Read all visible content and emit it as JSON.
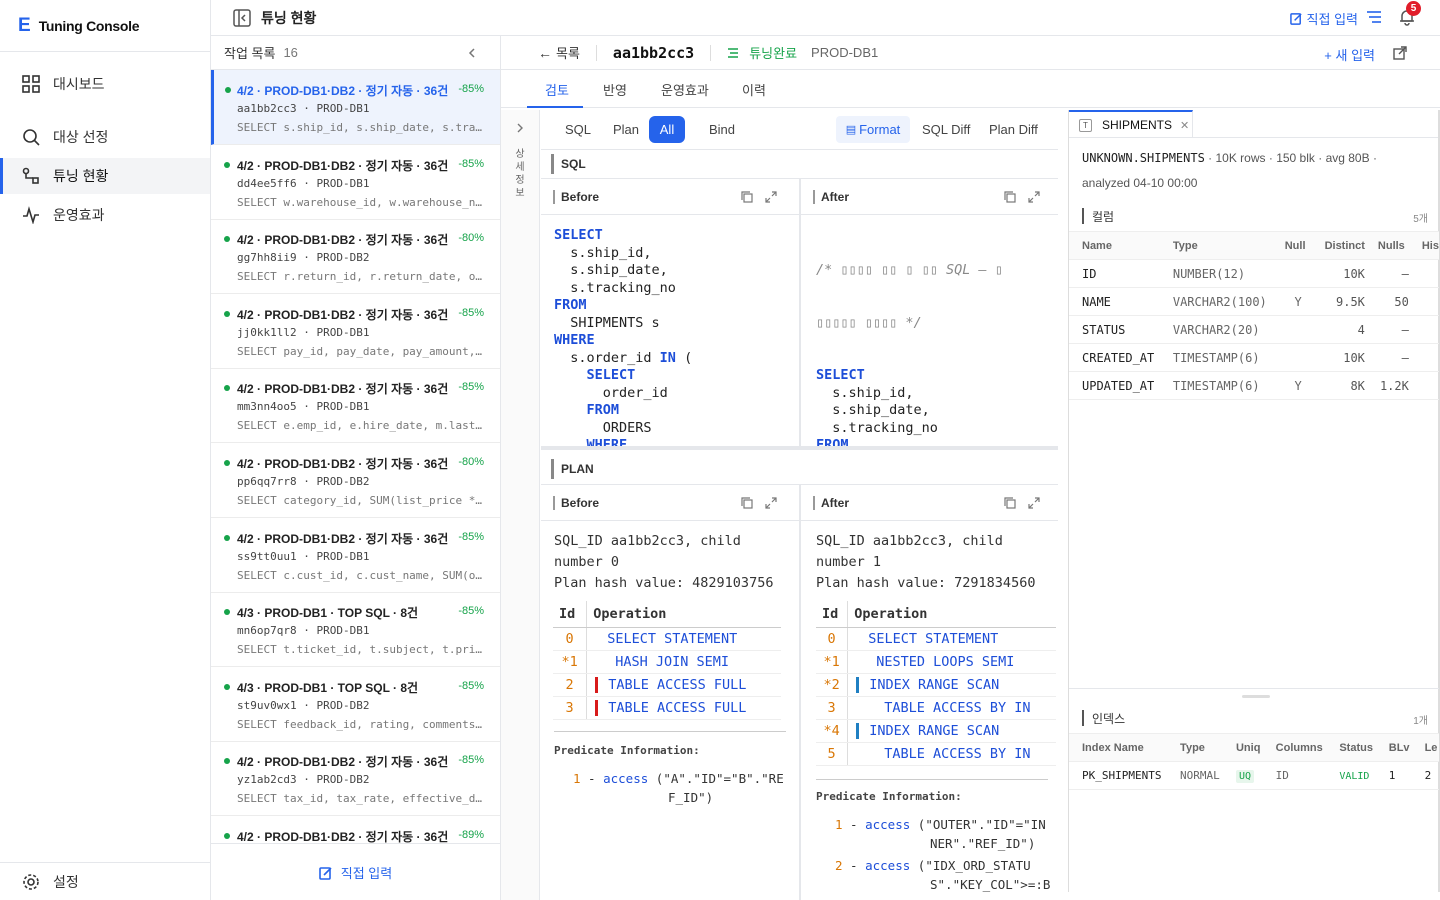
{
  "brand": {
    "logo": "E",
    "name": "Tuning Console"
  },
  "nav": {
    "items": [
      {
        "label": "대시보드",
        "icon": "grid-icon"
      },
      {
        "label": "대상 선정",
        "icon": "search-icon"
      },
      {
        "label": "튜닝 현황",
        "icon": "route-icon"
      },
      {
        "label": "운영효과",
        "icon": "activity-icon"
      }
    ],
    "active": "튜닝 현황",
    "settings": "설정"
  },
  "topbar": {
    "title": "튜닝 현황",
    "direct_input": "직접 입력",
    "notifications": "5"
  },
  "list": {
    "title": "작업 목록",
    "count": "16",
    "footer": "직접 입력",
    "jobs": [
      {
        "title": "4/2 · PROD-DB1·DB2 · 정기 자동 · 36건",
        "pct": "-85%",
        "id": "aa1bb2cc3 · PROD-DB1",
        "sql": "SELECT s.ship_id, s.ship_date, s.tracking_no"
      },
      {
        "title": "4/2 · PROD-DB1·DB2 · 정기 자동 · 36건",
        "pct": "-85%",
        "id": "dd4ee5ff6 · PROD-DB1",
        "sql": "SELECT w.warehouse_id, w.warehouse_name"
      },
      {
        "title": "4/2 · PROD-DB1·DB2 · 정기 자동 · 36건",
        "pct": "-80%",
        "id": "gg7hh8ii9 · PROD-DB2",
        "sql": "SELECT r.return_id, r.return_date, o.order_id"
      },
      {
        "title": "4/2 · PROD-DB1·DB2 · 정기 자동 · 36건",
        "pct": "-85%",
        "id": "jj0kk1ll2 · PROD-DB1",
        "sql": "SELECT pay_id, pay_date, pay_amount, status"
      },
      {
        "title": "4/2 · PROD-DB1·DB2 · 정기 자동 · 36건",
        "pct": "-85%",
        "id": "mm3nn4oo5 · PROD-DB1",
        "sql": "SELECT e.emp_id, e.hire_date, m.last_name"
      },
      {
        "title": "4/2 · PROD-DB1·DB2 · 정기 자동 · 36건",
        "pct": "-80%",
        "id": "pp6qq7rr8 · PROD-DB2",
        "sql": "SELECT category_id, SUM(list_price * qty)"
      },
      {
        "title": "4/2 · PROD-DB1·DB2 · 정기 자동 · 36건",
        "pct": "-85%",
        "id": "ss9tt0uu1 · PROD-DB1",
        "sql": "SELECT c.cust_id, c.cust_name, SUM(o.amount)"
      },
      {
        "title": "4/3 · PROD-DB1 · TOP SQL · 8건",
        "pct": "-85%",
        "id": "mn6op7qr8 · PROD-DB1",
        "sql": "SELECT t.ticket_id, t.subject, t.priority"
      },
      {
        "title": "4/3 · PROD-DB1 · TOP SQL · 8건",
        "pct": "-85%",
        "id": "st9uv0wx1 · PROD-DB2",
        "sql": "SELECT feedback_id, rating, comments, created"
      },
      {
        "title": "4/2 · PROD-DB1·DB2 · 정기 자동 · 36건",
        "pct": "-85%",
        "id": "yz1ab2cd3 · PROD-DB2",
        "sql": "SELECT tax_id, tax_rate, effective_date"
      },
      {
        "title": "4/2 · PROD-DB1·DB2 · 정기 자동 · 36건",
        "pct": "-89%",
        "id": "",
        "sql": ""
      }
    ]
  },
  "main": {
    "back": "목록",
    "sql_id": "aa1bb2cc3",
    "status": "튜닝완료",
    "db": "PROD-DB1",
    "new_input": "+ 새 입력",
    "tabs": [
      "검토",
      "반영",
      "운영효과",
      "이력"
    ],
    "side_label": "상세정보",
    "subtabs": [
      "SQL",
      "Plan",
      "All",
      "Bind"
    ],
    "view_tabs": [
      "Format",
      "SQL Diff",
      "Plan Diff"
    ],
    "sql_section": "SQL",
    "plan_section": "PLAN",
    "before": "Before",
    "after": "After",
    "before_sql": [
      "SELECT",
      "  s.ship_id,",
      "  s.ship_date,",
      "  s.tracking_no",
      "FROM",
      "  SHIPMENTS s",
      "WHERE",
      "  s.order_id IN (",
      "    SELECT",
      "      order_id",
      "    FROM",
      "      ORDERS",
      "    WHERE"
    ],
    "after_comment": "/* ▯▯▯▯ ▯▯ ▯ ▯▯ SQL — ▯",
    "after_comment2": "▯▯▯▯▯ ▯▯▯▯ */",
    "after_sql": [
      "SELECT",
      "  s.ship_id,",
      "  s.ship_date,",
      "  s.tracking_no",
      "FROM",
      "  SHIPMENTS s",
      "WHERE",
      "  s.order_id IN (",
      "    SELECT",
      "      order_id",
      "    FROM"
    ],
    "plan_before": {
      "l1": "SQL_ID aa1bb2cc3, child",
      "l2": "number 0",
      "l3": "Plan hash value: 4829103756",
      "head_id": "Id",
      "head_op": "Operation",
      "rows": [
        {
          "id": "0",
          "op": "SELECT STATEMENT",
          "bar": ""
        },
        {
          "id": "*1",
          "op": "HASH JOIN SEMI",
          "bar": ""
        },
        {
          "id": "2",
          "op": "TABLE ACCESS FULL",
          "bar": "#d81b1b"
        },
        {
          "id": "3",
          "op": "TABLE ACCESS FULL",
          "bar": "#d81b1b"
        }
      ],
      "pred_title": "Predicate Information:",
      "preds": [
        {
          "n": "1",
          "op": "access",
          "v": "(\"A\".\"ID\"=\"B\".\"RE",
          "v2": "F_ID\")"
        }
      ]
    },
    "plan_after": {
      "l1": "SQL_ID aa1bb2cc3, child",
      "l2": "number 1",
      "l3": "Plan hash value: 7291834560",
      "head_id": "Id",
      "head_op": "Operation",
      "rows": [
        {
          "id": "0",
          "op": "SELECT STATEMENT",
          "bar": ""
        },
        {
          "id": "*1",
          "op": "NESTED LOOPS SEMI",
          "bar": ""
        },
        {
          "id": "*2",
          "op": "INDEX RANGE SCAN",
          "bar": "#1f7fc2"
        },
        {
          "id": "3",
          "op": "TABLE ACCESS BY IN",
          "bar": ""
        },
        {
          "id": "*4",
          "op": "INDEX RANGE SCAN",
          "bar": "#1f7fc2"
        },
        {
          "id": "5",
          "op": "TABLE ACCESS BY IN",
          "bar": ""
        }
      ],
      "pred_title": "Predicate Information:",
      "preds": [
        {
          "n": "1",
          "op": "access",
          "v": "(\"OUTER\".\"ID\"=\"IN",
          "v2": "NER\".\"REF_ID\")"
        },
        {
          "n": "2",
          "op": "access",
          "v": "(\"IDX_ORD_STATU",
          "v2": "S\".\"KEY_COL\">=:B"
        }
      ]
    }
  },
  "right": {
    "tab": "SHIPMENTS",
    "tab_icon": "T",
    "info1": "UNKNOWN.SHIPMENTS",
    "info2": "10K rows",
    "info3": "150 blk",
    "info4": "avg 80B",
    "info5": "analyzed 04-10 00:00",
    "columns_title": "컬럼",
    "columns_count": "5개",
    "col_headers": [
      "Name",
      "Type",
      "Null",
      "Distinct",
      "Nulls",
      "His"
    ],
    "columns": [
      [
        "ID",
        "NUMBER(12)",
        "",
        "10K",
        "—"
      ],
      [
        "NAME",
        "VARCHAR2(100)",
        "Y",
        "9.5K",
        "50"
      ],
      [
        "STATUS",
        "VARCHAR2(20)",
        "",
        "4",
        "—"
      ],
      [
        "CREATED_AT",
        "TIMESTAMP(6)",
        "",
        "10K",
        "—"
      ],
      [
        "UPDATED_AT",
        "TIMESTAMP(6)",
        "Y",
        "8K",
        "1.2K"
      ]
    ],
    "index_title": "인덱스",
    "index_count": "1개",
    "idx_headers": [
      "Index Name",
      "Type",
      "Uniq",
      "Columns",
      "Status",
      "BLv",
      "Le"
    ],
    "indexes": [
      [
        "PK_SHIPMENTS",
        "NORMAL",
        "UQ",
        "ID",
        "VALID",
        "1",
        "2"
      ]
    ]
  }
}
